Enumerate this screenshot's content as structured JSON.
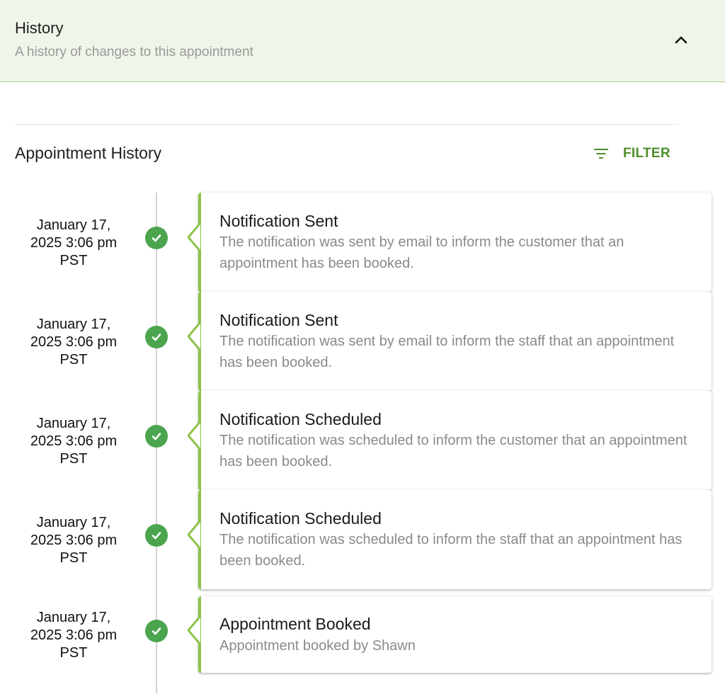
{
  "header": {
    "title": "History",
    "subtitle": "A history of changes to this appointment",
    "accent_color": "#eff5e8"
  },
  "section": {
    "title": "Appointment History",
    "filter_label": "FILTER",
    "filter_color": "#4f8f2a"
  },
  "icons": {
    "collapse": "chevron-up-icon",
    "filter": "filter-list-icon",
    "status": "check-circle-icon"
  },
  "status_color": "#4aa54e",
  "entries": [
    {
      "date_line1": "January 17,",
      "date_line2": "2025 3:06 pm",
      "date_line3": "PST",
      "title": "Notification Sent",
      "description": "The notification was sent by email to inform the customer that an appointment has been booked."
    },
    {
      "date_line1": "January 17,",
      "date_line2": "2025 3:06 pm",
      "date_line3": "PST",
      "title": "Notification Sent",
      "description": "The notification was sent by email to inform the staff that an appointment has been booked."
    },
    {
      "date_line1": "January 17,",
      "date_line2": "2025 3:06 pm",
      "date_line3": "PST",
      "title": "Notification Scheduled",
      "description": "The notification was scheduled to inform the customer that an appointment has been booked."
    },
    {
      "date_line1": "January 17,",
      "date_line2": "2025 3:06 pm",
      "date_line3": "PST",
      "title": "Notification Scheduled",
      "description": "The notification was scheduled to inform the staff that an appointment has been booked."
    },
    {
      "date_line1": "January 17,",
      "date_line2": "2025 3:06 pm",
      "date_line3": "PST",
      "title": "Appointment Booked",
      "description": "Appointment booked by Shawn"
    }
  ]
}
